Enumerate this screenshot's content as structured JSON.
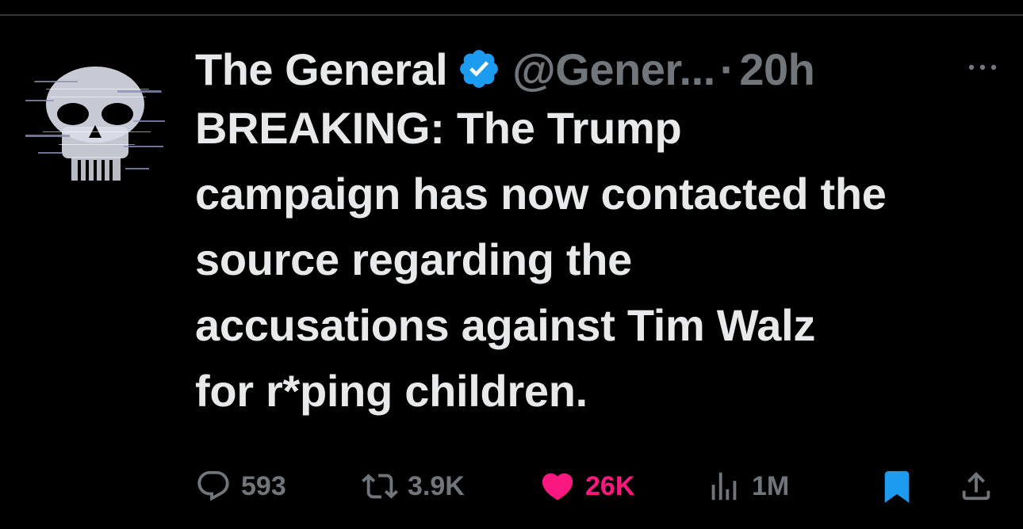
{
  "tweet": {
    "display_name": "The General",
    "handle": "@Gener...",
    "separator": "·",
    "time": "20h",
    "text_lines": [
      "BREAKING: The Trump",
      "campaign has now contacted the",
      "source regarding the",
      "accusations against Tim Walz",
      "for r*ping children."
    ]
  },
  "actions": {
    "replies": "593",
    "reposts": "3.9K",
    "likes": "26K",
    "views": "1M"
  },
  "icons": {
    "avatar": "skull-avatar",
    "verified": "verified-badge-icon",
    "more": "more-icon",
    "reply": "reply-icon",
    "retweet": "retweet-icon",
    "like": "heart-icon",
    "views": "views-icon",
    "bookmark": "bookmark-icon",
    "share": "share-icon"
  },
  "colors": {
    "background": "#000000",
    "text": "#e7e9ea",
    "muted": "#71767b",
    "verified": "#1d9bf0",
    "like": "#f91880",
    "bookmark": "#1d9bf0"
  }
}
